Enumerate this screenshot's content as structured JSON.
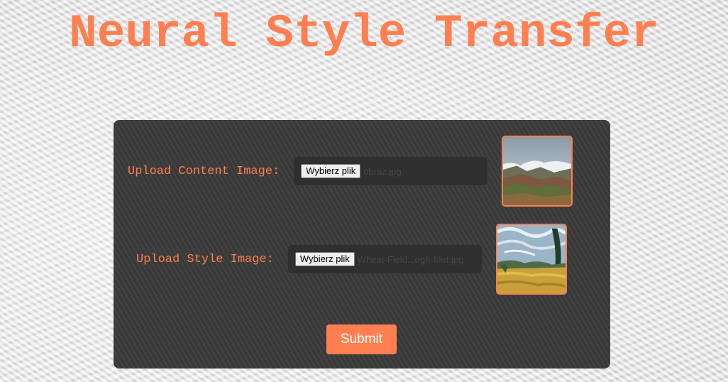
{
  "page": {
    "title": "Neural Style Transfer"
  },
  "form": {
    "content": {
      "label": "Upload Content Image:",
      "button_label": "Wybierz plik",
      "file_name": "obraz.jpg",
      "preview_icon": "mountain-landscape-image"
    },
    "style": {
      "label": "Upload Style Image:",
      "button_label": "Wybierz plik",
      "file_name": "Wheat-Field...ogh-Met.jpg",
      "preview_icon": "wheat-field-painting-image"
    },
    "submit_label": "Submit"
  },
  "colors": {
    "accent": "#ff7f50",
    "panel": "#3c3c3c",
    "file_box": "#2f2f2f"
  }
}
